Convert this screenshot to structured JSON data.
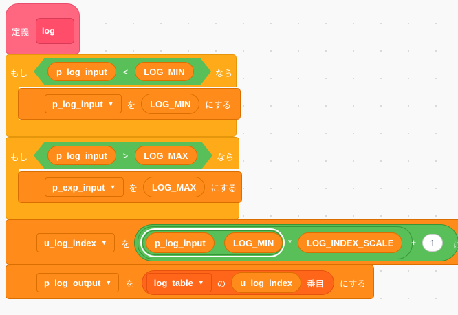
{
  "define_block": {
    "label": "定義",
    "name": "log"
  },
  "if_block_1": {
    "keyword": "もし",
    "left": "p_log_input",
    "operator": "<",
    "right": "LOG_MIN",
    "then": "なら",
    "set": {
      "variable": "p_log_input",
      "to": "を",
      "value": "LOG_MIN",
      "suffix": "にする"
    }
  },
  "if_block_2": {
    "keyword": "もし",
    "left": "p_log_input",
    "operator": ">",
    "right": "LOG_MAX",
    "then": "なら",
    "set": {
      "variable": "p_exp_input",
      "to": "を",
      "value": "LOG_MAX",
      "suffix": "にする"
    }
  },
  "set_index": {
    "variable": "u_log_index",
    "to": "を",
    "expr": {
      "a": "p_log_input",
      "minus": "-",
      "b": "LOG_MIN",
      "times": "*",
      "c": "LOG_INDEX_SCALE",
      "plus": "+",
      "d": "1"
    },
    "suffix_clipped": "に"
  },
  "set_output": {
    "variable": "p_log_output",
    "to": "を",
    "list": "log_table",
    "of": "の",
    "index": "u_log_index",
    "item": "番目",
    "suffix": "にする"
  },
  "colors": {
    "events_hat": "#ff6680",
    "control": "#ffab19",
    "variables": "#ff8c1a",
    "lists": "#ff661a",
    "operators": "#59c059"
  }
}
